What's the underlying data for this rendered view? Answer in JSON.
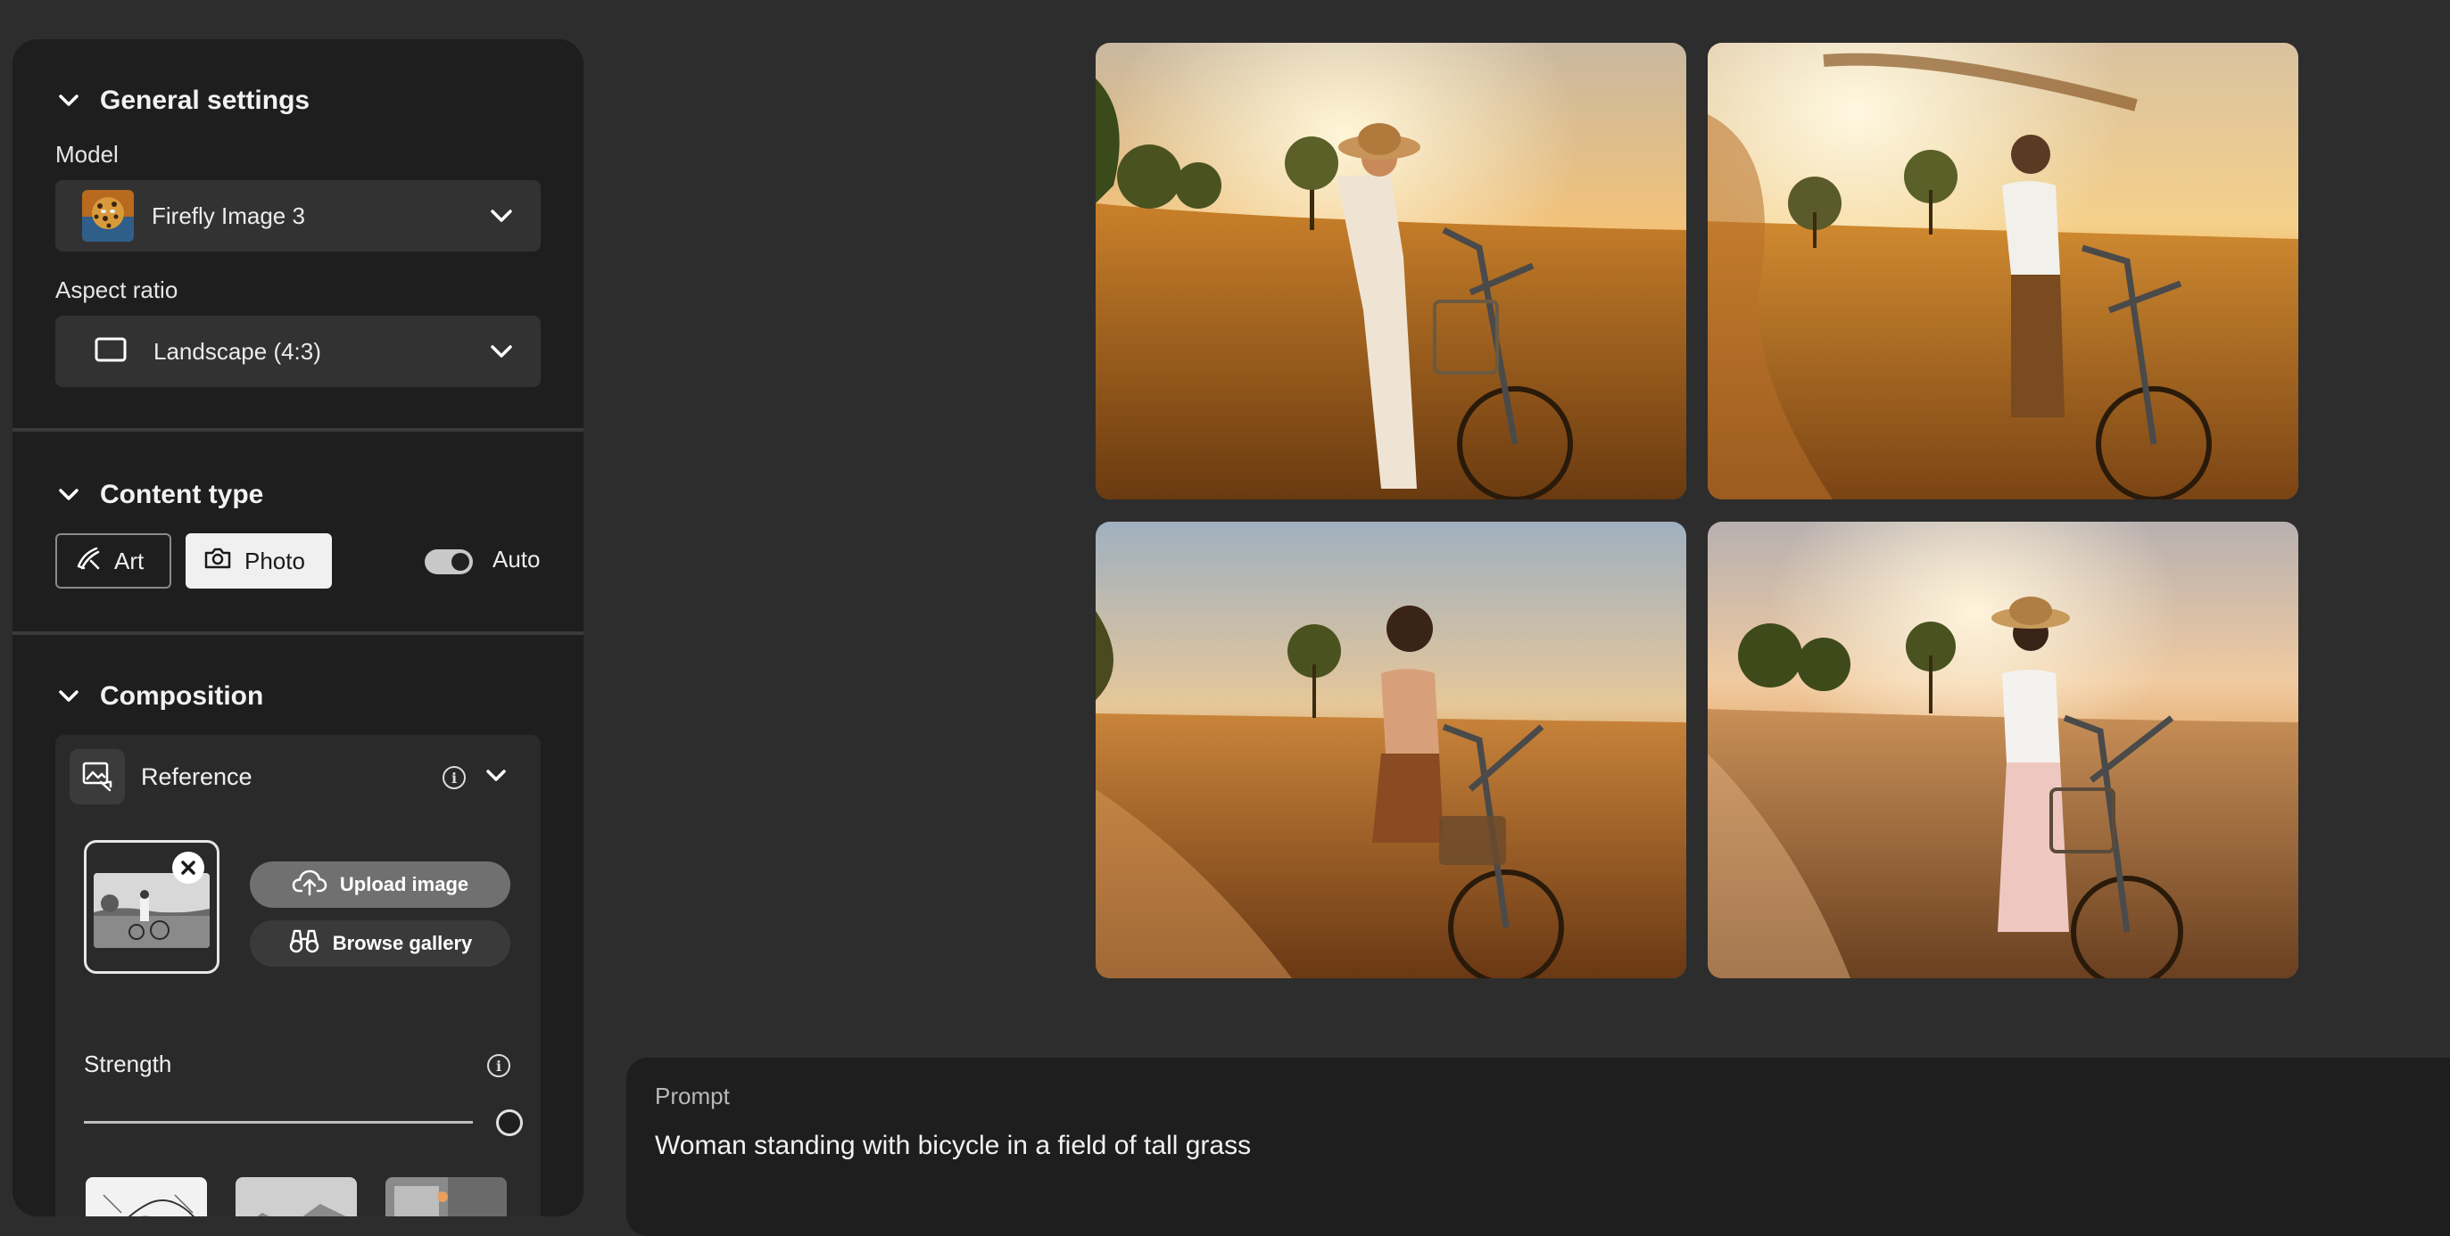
{
  "general": {
    "title": "General settings",
    "model_label": "Model",
    "model_value": "Firefly Image 3",
    "aspect_label": "Aspect ratio",
    "aspect_value": "Landscape (4:3)"
  },
  "content_type": {
    "title": "Content type",
    "art_label": "Art",
    "photo_label": "Photo",
    "auto_label": "Auto",
    "selected": "Photo",
    "auto_on": true
  },
  "composition": {
    "title": "Composition",
    "reference_label": "Reference",
    "upload_label": "Upload image",
    "browse_label": "Browse gallery",
    "strength_label": "Strength",
    "strength_value": 1.0
  },
  "prompt": {
    "label": "Prompt",
    "text": "Woman standing with bicycle in a field of tall grass"
  },
  "icons": [
    "chevron-down-icon",
    "leopard-model-thumbnail",
    "landscape-ratio-icon",
    "art-brush-icon",
    "camera-icon",
    "reference-image-icon",
    "info-icon",
    "close-icon",
    "upload-cloud-icon",
    "binoculars-icon"
  ],
  "colors": {
    "background": "#2d2d2d",
    "panel": "#1e1e1e",
    "control": "#323232",
    "selected_button": "#f0f0f0",
    "pill_upload": "#707070",
    "pill_browse": "#3a3a3a"
  }
}
